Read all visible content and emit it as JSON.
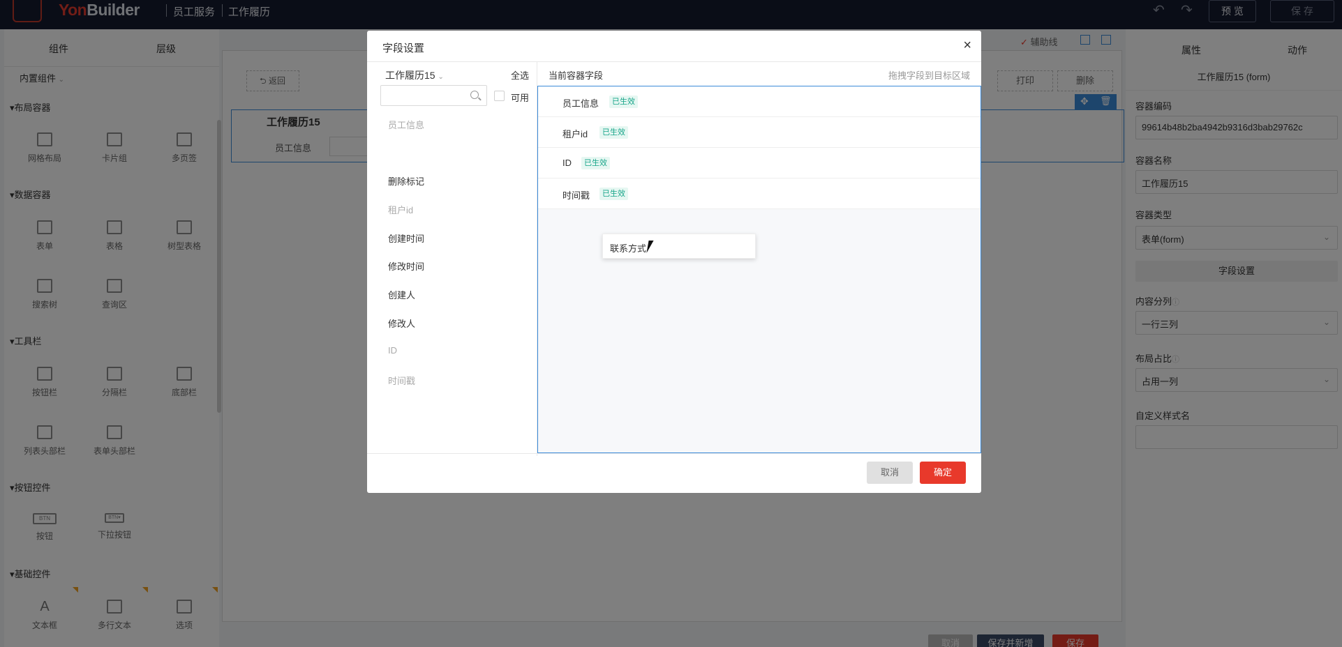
{
  "topbar": {
    "brand_yon": "Yon",
    "brand_builder": "Builder",
    "crumb1": "员工服务",
    "crumb2": "工作履历",
    "preview": "预 览",
    "save": "保 存"
  },
  "leftpanel": {
    "tabs": [
      "组件",
      "层级"
    ],
    "dropdown": "内置组件",
    "sections": [
      "布局容器",
      "数据容器",
      "工具栏",
      "按钮控件",
      "基础控件"
    ],
    "tiles": [
      "网格布局",
      "卡片组",
      "多页签",
      "表单",
      "表格",
      "树型表格",
      "搜索树",
      "查询区",
      "按钮栏",
      "分隔栏",
      "底部栏",
      "列表头部栏",
      "表单头部栏",
      "按钮",
      "下拉按钮",
      "文本框",
      "多行文本",
      "选项"
    ],
    "tile_icon_text": [
      "BTN",
      "BTN▾"
    ]
  },
  "canvas": {
    "back": "返回",
    "print": "打印",
    "delete": "删除",
    "form_title": "工作履历15",
    "form_label": "员工信息",
    "bottom_buttons": [
      "取消",
      "保存并新增",
      "保存"
    ]
  },
  "aux": {
    "label": "辅助线"
  },
  "rightpanel": {
    "tabs": [
      "属性",
      "动作"
    ],
    "title": "工作履历15 (form)",
    "code_label": "容器编码",
    "code_value": "99614b48b2ba4942b9316d3bab29762c",
    "name_label": "容器名称",
    "name_value": "工作履历15",
    "type_label": "容器类型",
    "type_value": "表单(form)",
    "field_settings": "字段设置",
    "cols_label": "内容分列",
    "cols_value": "一行三列",
    "ratio_label": "布局占比",
    "ratio_value": "占用一列",
    "css_label": "自定义样式名"
  },
  "dialog": {
    "title": "字段设置",
    "close": "×",
    "source_dropdown": "工作履历15",
    "select_all": "全选",
    "available": "可用",
    "search_placeholder": "",
    "left_fields": [
      {
        "label": "员工信息",
        "enabled": false
      },
      {
        "label": "删除标记",
        "enabled": true
      },
      {
        "label": "租户id",
        "enabled": false
      },
      {
        "label": "创建时间",
        "enabled": true
      },
      {
        "label": "修改时间",
        "enabled": true
      },
      {
        "label": "创建人",
        "enabled": true
      },
      {
        "label": "修改人",
        "enabled": true
      },
      {
        "label": "ID",
        "enabled": false
      },
      {
        "label": "时间戳",
        "enabled": false
      }
    ],
    "right_header": "当前容器字段",
    "right_hint": "拖拽字段到目标区域",
    "status_tag": "已生效",
    "right_fields": [
      "员工信息",
      "租户id",
      "ID",
      "时间戳"
    ],
    "dragging": "联系方式",
    "cancel": "取消",
    "ok": "确定"
  },
  "colors": {
    "topbar": "#141a2e",
    "brand_red": "#e23a2e",
    "accent_blue": "#3b8ad9",
    "ok_red": "#e8392b",
    "tag_green": "#17a589"
  }
}
